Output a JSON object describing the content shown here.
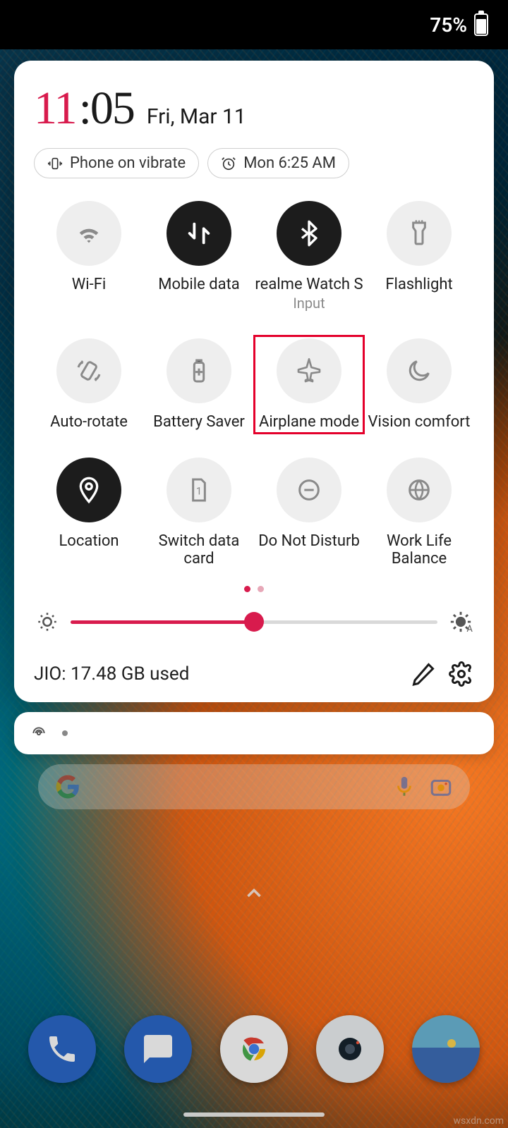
{
  "status": {
    "battery_percent": "75%"
  },
  "clock": {
    "hours": "11",
    "minutes": ":05",
    "date": "Fri, Mar 11"
  },
  "chips": {
    "vibrate": "Phone on vibrate",
    "alarm": "Mon 6:25 AM"
  },
  "tiles": [
    {
      "id": "wifi",
      "label": "Wi-Fi",
      "sublabel": "",
      "active": false,
      "icon": "wifi",
      "highlight": false
    },
    {
      "id": "mobile-data",
      "label": "Mobile data",
      "sublabel": "",
      "active": true,
      "icon": "data",
      "highlight": false
    },
    {
      "id": "bluetooth",
      "label": "realme Watch S",
      "sublabel": "Input",
      "active": true,
      "icon": "bluetooth",
      "highlight": false
    },
    {
      "id": "flashlight",
      "label": "Flashlight",
      "sublabel": "",
      "active": false,
      "icon": "flashlight",
      "highlight": false
    },
    {
      "id": "auto-rotate",
      "label": "Auto-rotate",
      "sublabel": "",
      "active": false,
      "icon": "rotate",
      "highlight": false
    },
    {
      "id": "battery-saver",
      "label": "Battery Saver",
      "sublabel": "",
      "active": false,
      "icon": "batterysaver",
      "highlight": false
    },
    {
      "id": "airplane-mode",
      "label": "Airplane mode",
      "sublabel": "",
      "active": false,
      "icon": "airplane",
      "highlight": true
    },
    {
      "id": "vision-comfort",
      "label": "Vision comfort",
      "sublabel": "",
      "active": false,
      "icon": "moon",
      "highlight": false
    },
    {
      "id": "location",
      "label": "Location",
      "sublabel": "",
      "active": true,
      "icon": "location",
      "highlight": false
    },
    {
      "id": "switch-data",
      "label": "Switch data card",
      "sublabel": "",
      "active": false,
      "icon": "sim",
      "highlight": false
    },
    {
      "id": "dnd",
      "label": "Do Not Disturb",
      "sublabel": "",
      "active": false,
      "icon": "dnd",
      "highlight": false
    },
    {
      "id": "work-life",
      "label": "Work Life Balance",
      "sublabel": "",
      "active": false,
      "icon": "globe",
      "highlight": false
    }
  ],
  "pager": {
    "pages": 2,
    "current": 0
  },
  "brightness": {
    "percent": 50
  },
  "footer": {
    "usage": "JIO: 17.48 GB used"
  },
  "colors": {
    "accent": "#d81b4d",
    "active_tile": "#1c1c1c",
    "inactive_tile": "#eeeeee",
    "highlight": "#e4002b"
  },
  "watermark": "wsxdn.com"
}
